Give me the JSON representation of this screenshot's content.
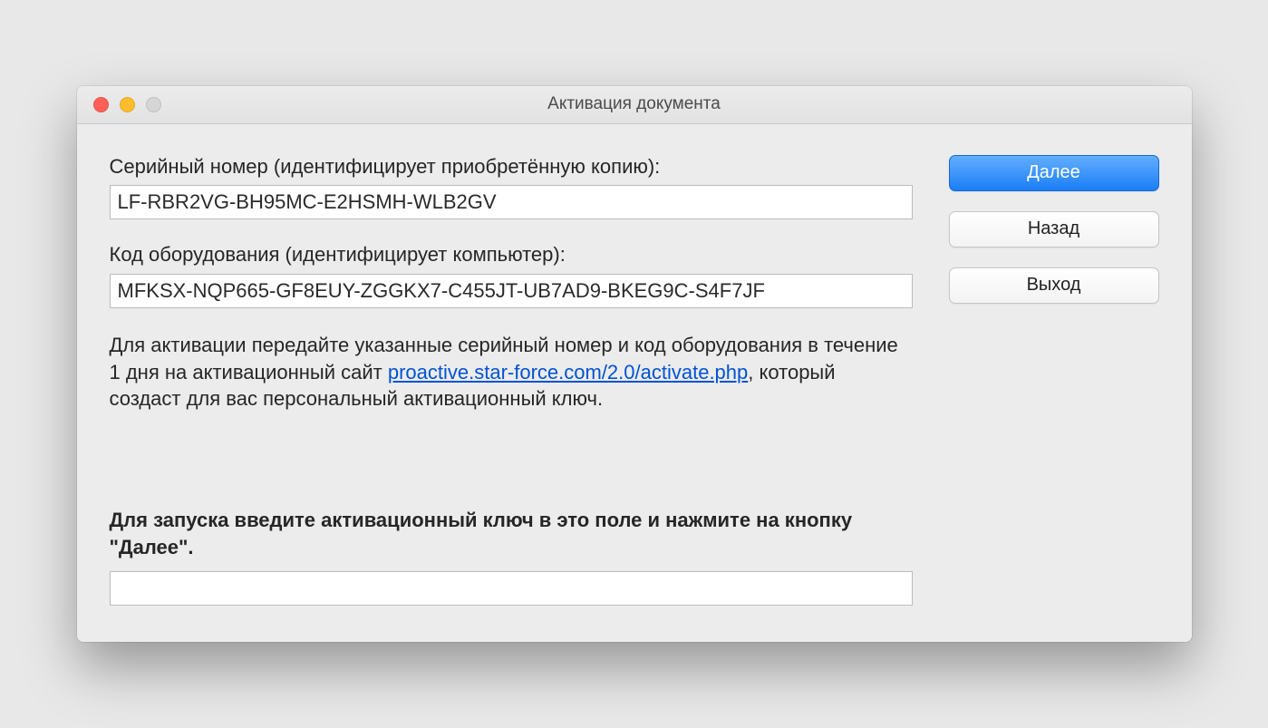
{
  "window": {
    "title": "Активация документа"
  },
  "form": {
    "serial_label": "Серийный номер (идентифицирует приобретённую копию):",
    "serial_value": "LF-RBR2VG-BH95MC-E2HSMH-WLB2GV",
    "hardware_label": "Код оборудования (идентифицирует компьютер):",
    "hardware_value": "MFKSX-NQP665-GF8EUY-ZGGKX7-C455JT-UB7AD9-BKEG9C-S4F7JF",
    "instructions_pre": "Для активации передайте указанные серийный номер и код оборудования в течение 1 дня на активационный сайт ",
    "instructions_link": "proactive.star-force.com/2.0/activate.php",
    "instructions_post": ", который создаст для вас персональный активационный ключ.",
    "bold_instructions": "Для запуска введите активационный ключ в это поле и нажмите на кнопку \"Далее\".",
    "activation_value": ""
  },
  "buttons": {
    "next": "Далее",
    "back": "Назад",
    "exit": "Выход"
  }
}
